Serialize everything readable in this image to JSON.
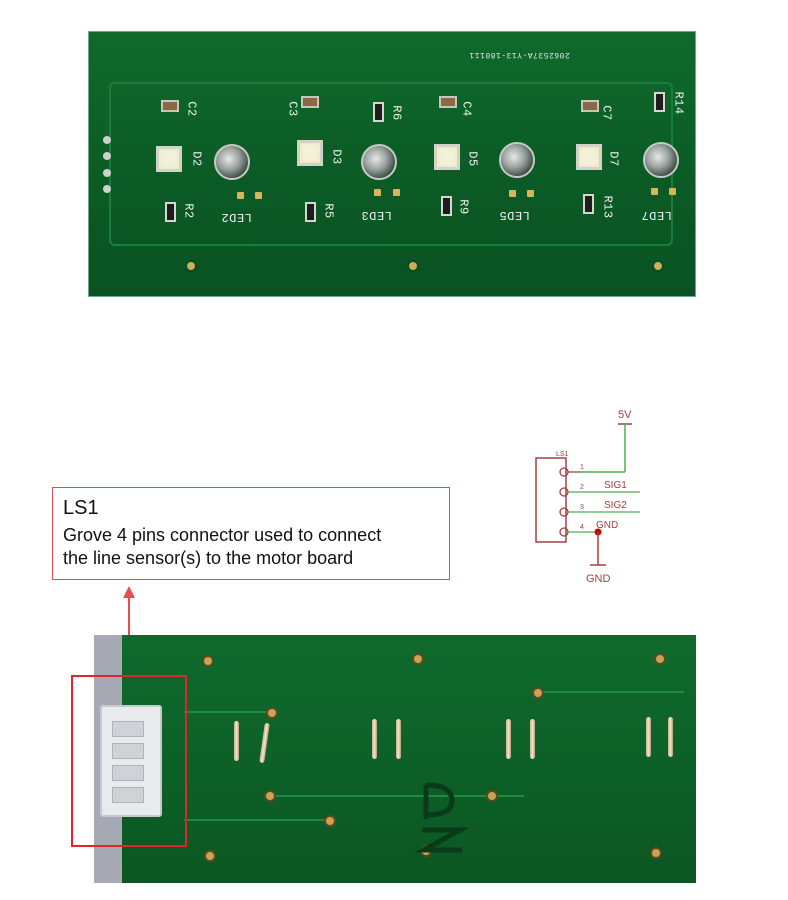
{
  "top_board": {
    "serial": "2062537A-Y13-180111",
    "capacitors": [
      "C2",
      "C3",
      "C4",
      "C7"
    ],
    "diodes": [
      "D2",
      "D3",
      "D5",
      "D7"
    ],
    "resistors": [
      "R2",
      "R5",
      "R6",
      "R9",
      "R13",
      "R14"
    ],
    "leds": [
      "LED2",
      "LED3",
      "LED5",
      "LED7"
    ]
  },
  "schematic": {
    "part": "LS1",
    "power_label": "5V",
    "ground_label": "GND",
    "pins": [
      {
        "num": "1",
        "label": ""
      },
      {
        "num": "2",
        "label": "SIG1"
      },
      {
        "num": "3",
        "label": "SIG2"
      },
      {
        "num": "4",
        "label": "GND"
      }
    ],
    "colors": {
      "wire": "#4caf50",
      "symbol": "#a04040",
      "junction": "#cc0000"
    }
  },
  "callout": {
    "title": "LS1",
    "description_line1": "Grove 4 pins connector used to connect",
    "description_line2": "the line sensor(s) to the motor board",
    "color": "#e05050"
  },
  "bottom_board": {
    "highlight_color": "#e0262a"
  }
}
